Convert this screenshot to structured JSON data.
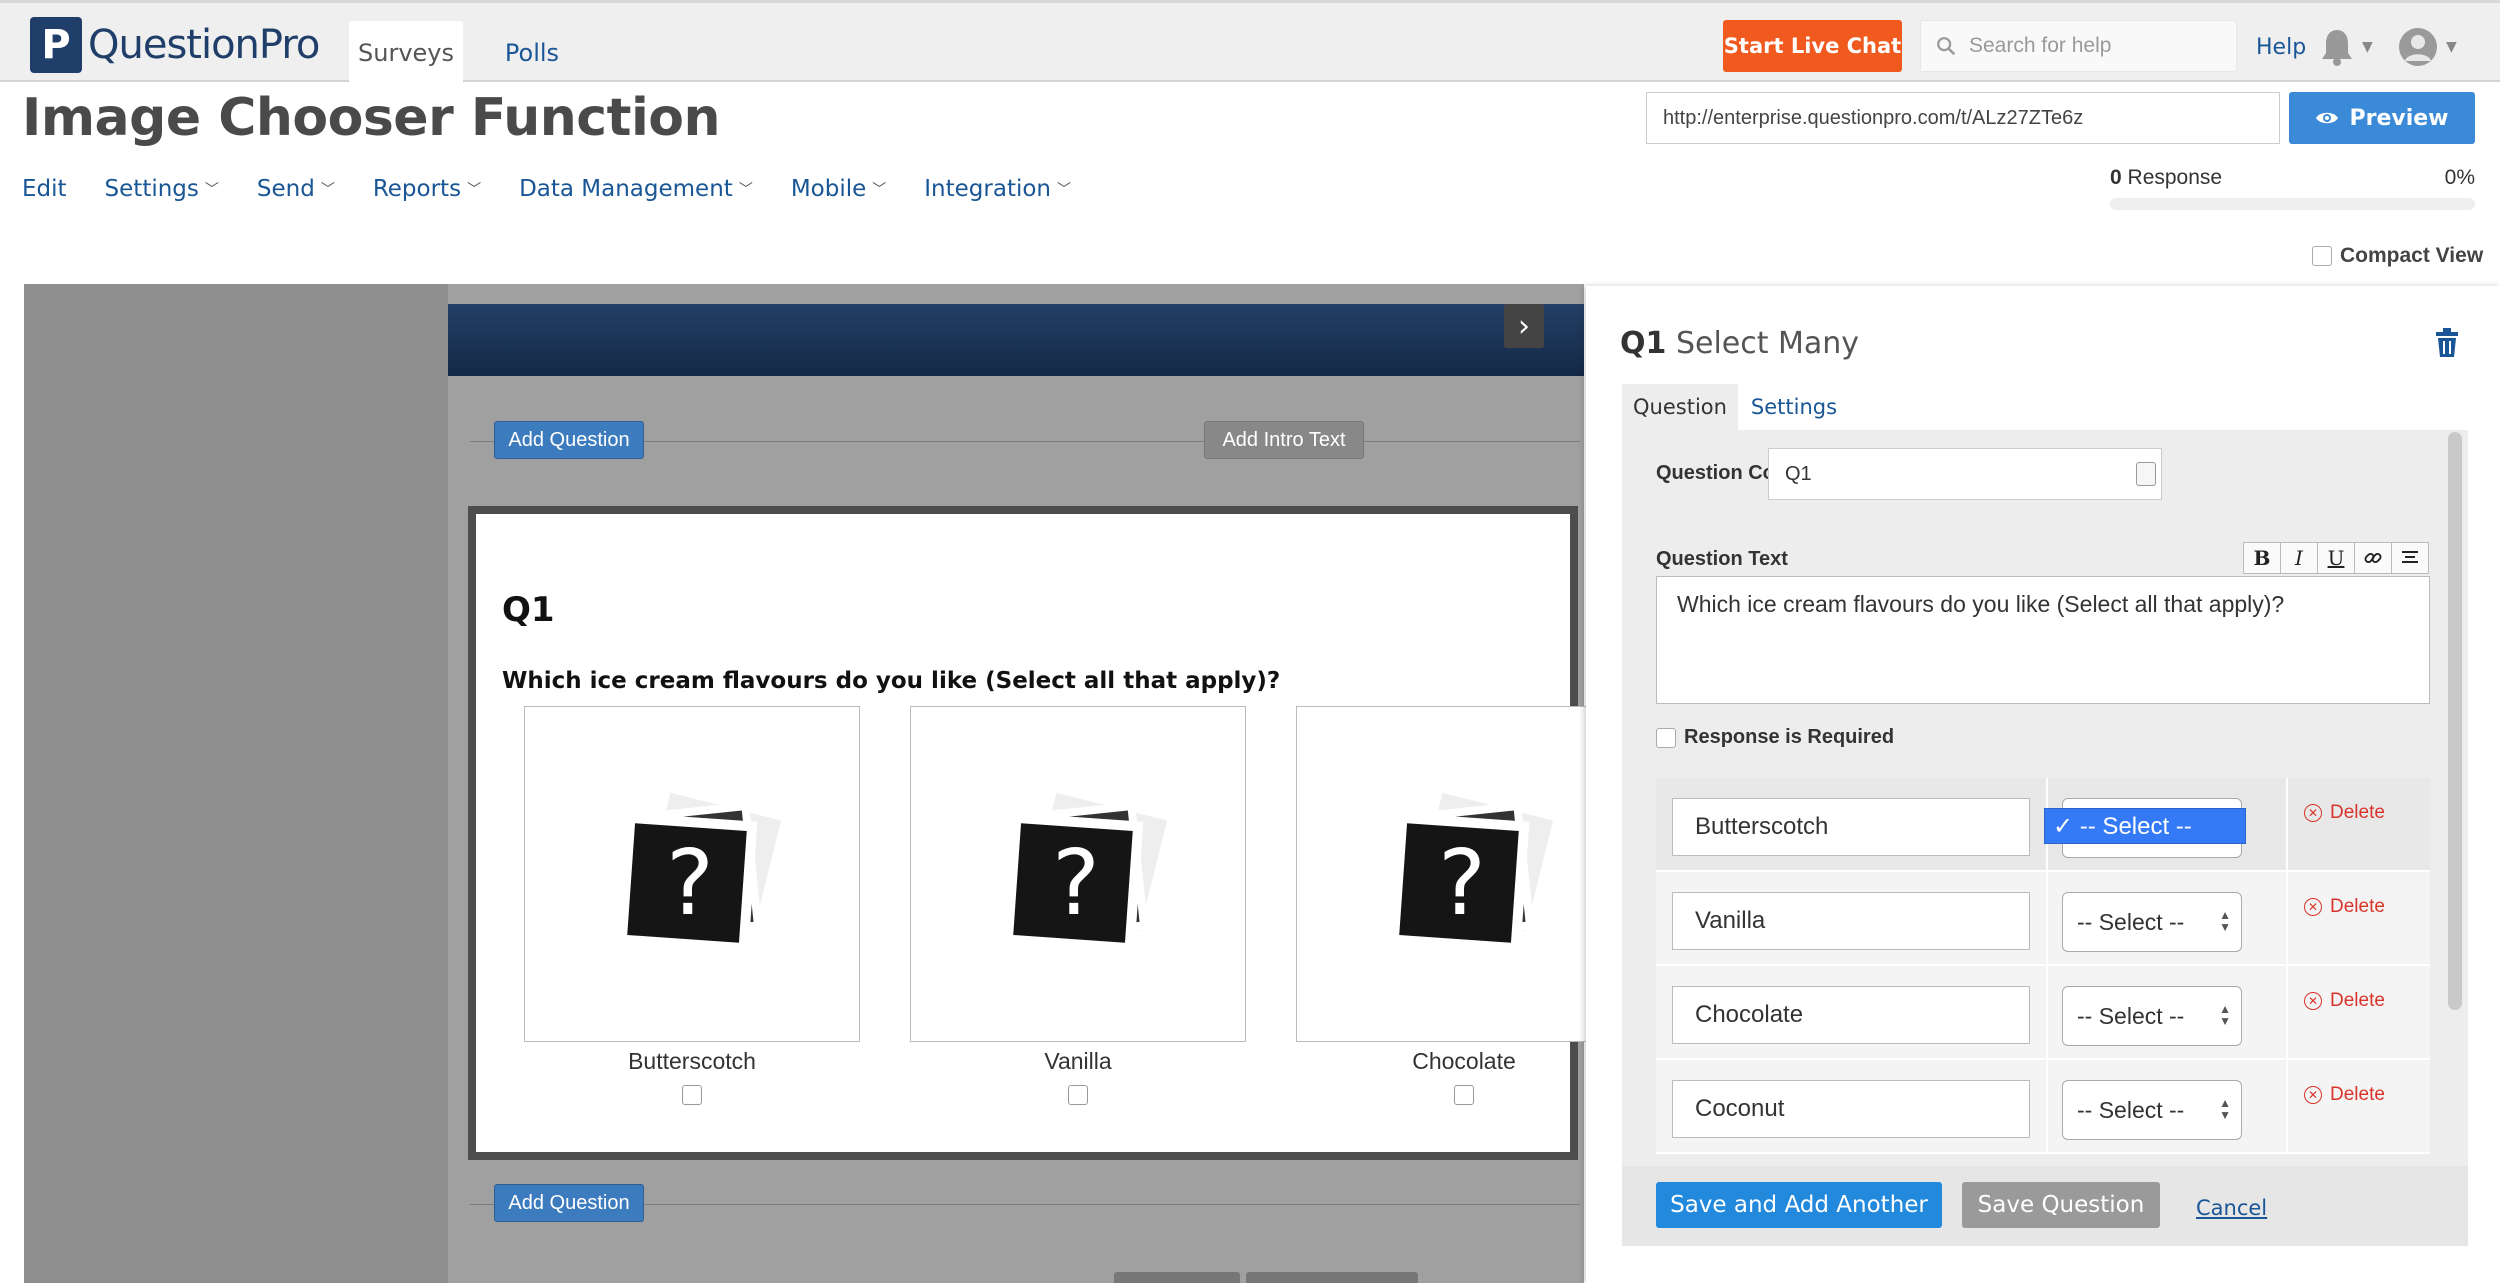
{
  "brand": {
    "logo_letter": "P",
    "logo_text": "QuestionPro"
  },
  "topnav": {
    "tabs": [
      "Surveys",
      "Polls"
    ],
    "live_chat": "Start Live Chat",
    "search_placeholder": "Search for help",
    "help": "Help"
  },
  "page": {
    "title": "Image Chooser Function",
    "url": "http://enterprise.questionpro.com/t/ALz27ZTe6z",
    "preview": "Preview"
  },
  "subnav": [
    "Edit",
    "Settings",
    "Send",
    "Reports",
    "Data Management",
    "Mobile",
    "Integration"
  ],
  "responses": {
    "count": "0",
    "label": "Response",
    "percent": "0%"
  },
  "compact_view": "Compact View",
  "editor": {
    "add_question": "Add Question",
    "add_intro": "Add Intro Text",
    "question": {
      "number": "Q1",
      "text": "Which ice cream flavours do you like (Select all that apply)?",
      "options": [
        "Butterscotch",
        "Vanilla",
        "Chocolate"
      ]
    }
  },
  "panel": {
    "qnum": "Q1",
    "qtype": "Select Many",
    "tabs": [
      "Question",
      "Settings"
    ],
    "code_label": "Question Code",
    "code_value": "Q1",
    "text_label": "Question Text",
    "text_value": "Which ice cream flavours do you like (Select all that apply)?",
    "format_buttons": [
      "B",
      "I",
      "U"
    ],
    "required_label": "Response is Required",
    "answers": [
      "Butterscotch",
      "Vanilla",
      "Chocolate",
      "Coconut"
    ],
    "select_label": "-- Select --",
    "open_select": "✓ -- Select --",
    "delete_label": "Delete",
    "save_add": "Save and Add Another",
    "save": "Save Question",
    "cancel": "Cancel"
  },
  "colors": {
    "brand": "#1f3e69",
    "accent": "#3b8ad8",
    "live_chat": "#f15a1f",
    "delete": "#d9342b"
  }
}
